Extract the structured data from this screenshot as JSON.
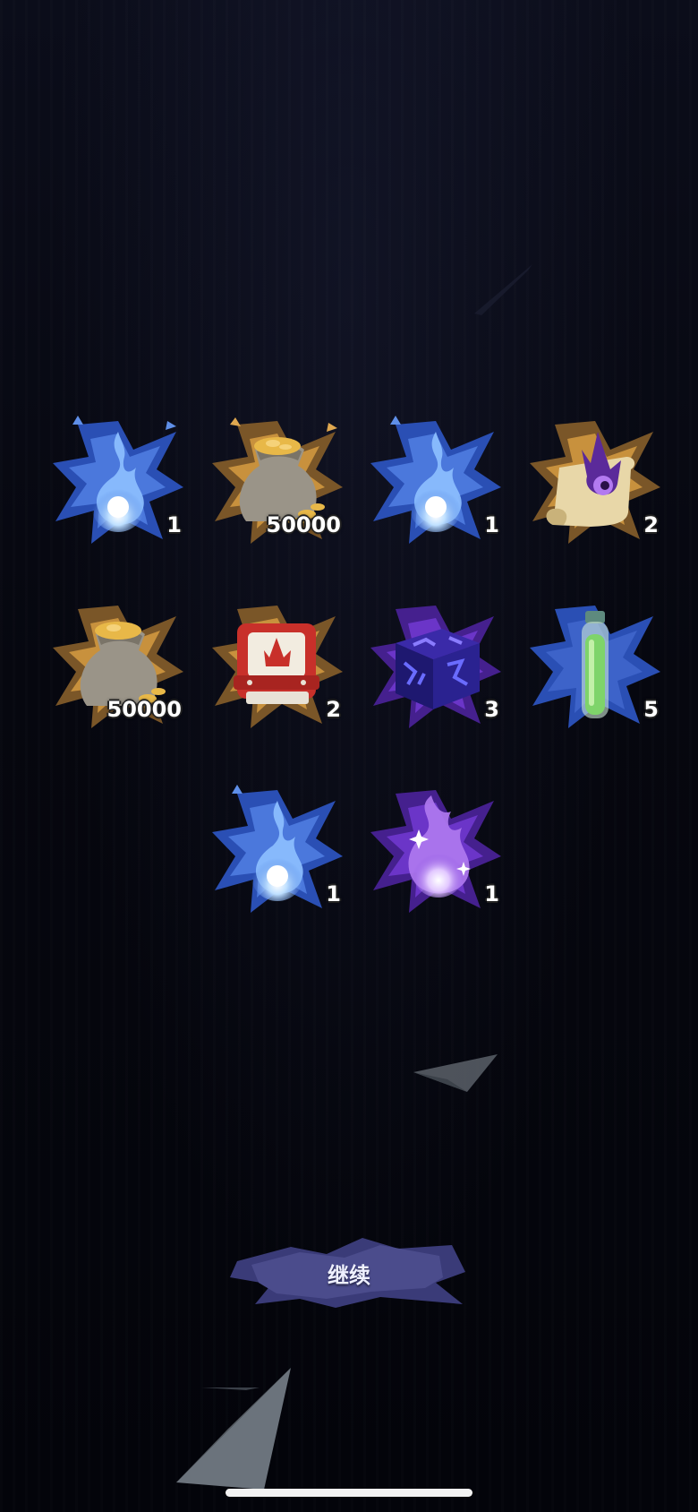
{
  "rewards": [
    {
      "name": "blue-flame",
      "count": "1",
      "theme": "blue"
    },
    {
      "name": "gold-sack",
      "count": "50000",
      "theme": "gold"
    },
    {
      "name": "blue-flame",
      "count": "1",
      "theme": "blue"
    },
    {
      "name": "purple-scroll",
      "count": "2",
      "theme": "gold"
    },
    {
      "name": "gold-sack",
      "count": "50000",
      "theme": "gold"
    },
    {
      "name": "red-chest",
      "count": "2",
      "theme": "gold"
    },
    {
      "name": "purple-rune-cube",
      "count": "3",
      "theme": "purple"
    },
    {
      "name": "green-potion",
      "count": "5",
      "theme": "blue"
    },
    {
      "name": "blue-flame",
      "count": "1",
      "theme": "blue"
    },
    {
      "name": "purple-spirit-flame",
      "count": "1",
      "theme": "purple"
    }
  ],
  "continue_label": "继续",
  "colors": {
    "blue_burst": "#3d63c9",
    "gold_burst": "#c8913d",
    "purple_burst": "#6b35c8",
    "button": "#4b4c8c"
  }
}
